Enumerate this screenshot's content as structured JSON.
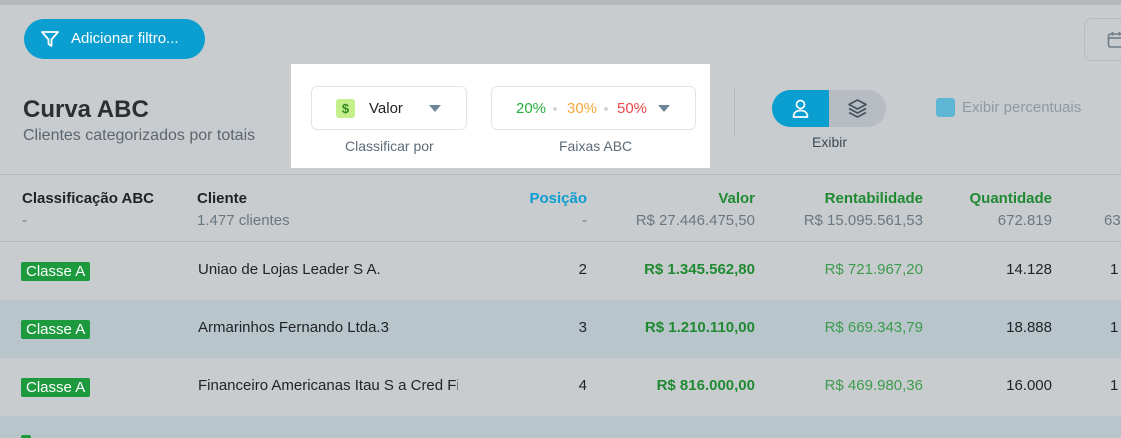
{
  "toolbar": {
    "filter_label": "Adicionar filtro..."
  },
  "header": {
    "title": "Curva ABC",
    "subtitle": "Clientes categorizados por totais"
  },
  "sort": {
    "icon": "$",
    "value": "Valor",
    "caption": "Classificar por"
  },
  "bands": {
    "a": "20%",
    "b": "30%",
    "c": "50%",
    "caption": "Faixas ABC",
    "colors": {
      "a": "#27ae3d",
      "b": "#f0a83a",
      "c": "#e8484d"
    }
  },
  "view": {
    "label": "Exibir",
    "options": [
      "person-icon",
      "layers-icon"
    ],
    "selected": "person-icon"
  },
  "show_percent": {
    "label": "Exibir percentuais",
    "checked": true
  },
  "table": {
    "columns": {
      "classification": "Classificação ABC",
      "client": "Cliente",
      "position": "Posição",
      "value": "Valor",
      "profit": "Rentabilidade",
      "quantity": "Quantidade"
    },
    "totals": {
      "classification": "-",
      "client": "1.477 clientes",
      "position": "-",
      "value": "R$ 27.446.475,50",
      "profit": "R$ 15.095.561,53",
      "quantity": "672.819",
      "extra": "63"
    },
    "rows": [
      {
        "class": "Classe A",
        "client": "Uniao de Lojas Leader S A.",
        "position": "2",
        "value": "R$ 1.345.562,80",
        "profit": "R$ 721.967,20",
        "quantity": "14.128",
        "extra": "1"
      },
      {
        "class": "Classe A",
        "client": "Armarinhos Fernando Ltda.3",
        "position": "3",
        "value": "R$ 1.210.110,00",
        "profit": "R$ 669.343,79",
        "quantity": "18.888",
        "extra": "1"
      },
      {
        "class": "Classe A",
        "client": "Financeiro Americanas Itau S a Cred Fi",
        "position": "4",
        "value": "R$ 816.000,00",
        "profit": "R$ 469.980,36",
        "quantity": "16.000",
        "extra": "1"
      }
    ]
  }
}
